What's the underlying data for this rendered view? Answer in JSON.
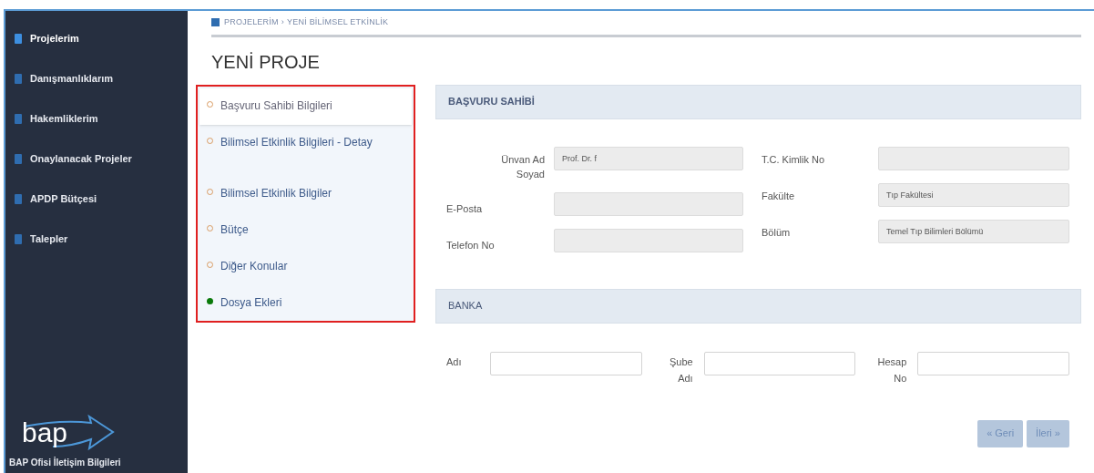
{
  "sidebar": {
    "items": [
      {
        "label": "Projelerim",
        "selected": true
      },
      {
        "label": "Danışmanlıklarım",
        "selected": false
      },
      {
        "label": "Hakemliklerim",
        "selected": false
      },
      {
        "label": "Onaylanacak Projeler",
        "selected": false
      },
      {
        "label": "APDP Bütçesi",
        "selected": false
      },
      {
        "label": "Talepler",
        "selected": false
      }
    ],
    "logo_text": "bap",
    "footer": "BAP Ofisi İletişim Bilgileri"
  },
  "breadcrumb": [
    "PROJELERİM",
    "›",
    "YENİ BİLİMSEL ETKİNLİK"
  ],
  "title": "YENİ PROJE",
  "steps": [
    {
      "label": "Başvuru Sahibi Bilgileri",
      "selected": true,
      "completed": false
    },
    {
      "label": "Bilimsel Etkinlik Bilgileri - Detay",
      "selected": false,
      "completed": false
    },
    {
      "label": "Bilimsel Etkinlik Bilgiler",
      "selected": false,
      "completed": false
    },
    {
      "label": "Bütçe",
      "selected": false,
      "completed": false
    },
    {
      "label": "Diğer Konular",
      "selected": false,
      "completed": false
    },
    {
      "label": "Dosya Ekleri",
      "selected": false,
      "completed": true
    }
  ],
  "applicant": {
    "heading": "BAŞVURU SAHİBİ",
    "left_fields": [
      {
        "label": "Ünvan Ad Soyad",
        "value": "Prof. Dr. f",
        "disabled": true
      },
      {
        "label": "E-Posta",
        "disabled": true
      },
      {
        "label": "Telefon No",
        "disabled": true
      }
    ],
    "right_fields": [
      {
        "label": "T.C. Kimlik No",
        "disabled": true
      },
      {
        "label": "Fakülte",
        "value": "Tıp Fakültesi",
        "disabled": true
      },
      {
        "label": "Bölüm",
        "value": "Temel Tıp Bilimleri Bölümü",
        "disabled": true
      }
    ]
  },
  "bank": {
    "heading": "BANKA",
    "fields": [
      {
        "label": "Adı",
        "disabled": false
      },
      {
        "label": "Şube Adı",
        "disabled": false
      },
      {
        "label": "Hesap No",
        "disabled": false
      }
    ]
  },
  "buttons": [
    {
      "label": "« Geri",
      "disabled": true
    },
    {
      "label": "İleri »",
      "disabled": true
    }
  ]
}
